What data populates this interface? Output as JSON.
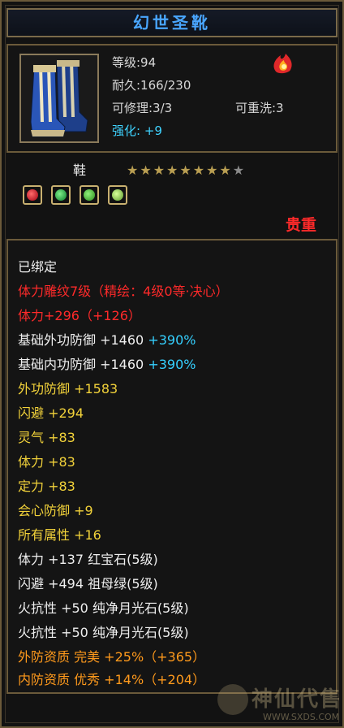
{
  "title": "幻世圣靴",
  "item": {
    "level": "等级:94",
    "durability": "耐久:166/230",
    "repair": "可修理:3/3",
    "rewash": "可重洗:3",
    "enhance": "强化: +9",
    "icon": "boots-icon",
    "type_icon": "flame-icon"
  },
  "slot": {
    "label": "鞋",
    "stars_total": 9,
    "stars_filled": 8,
    "gems": [
      "ruby-gem-icon",
      "emerald-gem-icon",
      "emerald-gem-icon",
      "moonstone-gem-icon"
    ]
  },
  "rarity": "贵重",
  "attributes": [
    {
      "text": "已绑定",
      "color": "white"
    },
    {
      "text": "体力雕纹7级（精绘：4级0等·决心）",
      "color": "red"
    },
    {
      "text": "体力+296（+126）",
      "color": "red"
    },
    {
      "text": "基础外功防御 +1460",
      "extra": "+390%",
      "color": "white"
    },
    {
      "text": "基础内功防御 +1460",
      "extra": "+390%",
      "color": "white"
    },
    {
      "text": "外功防御 +1583",
      "color": "yellow"
    },
    {
      "text": "闪避 +294",
      "color": "yellow"
    },
    {
      "text": "灵气 +83",
      "color": "yellow"
    },
    {
      "text": "体力 +83",
      "color": "yellow"
    },
    {
      "text": "定力 +83",
      "color": "yellow"
    },
    {
      "text": "会心防御 +9",
      "color": "yellow"
    },
    {
      "text": "所有属性 +16",
      "color": "yellow"
    },
    {
      "text": "体力 +137 红宝石(5级)",
      "color": "white"
    },
    {
      "text": "闪避 +494 祖母绿(5级)",
      "color": "white"
    },
    {
      "text": "火抗性 +50 纯净月光石(5级)",
      "color": "white"
    },
    {
      "text": "火抗性 +50 纯净月光石(5级)",
      "color": "white"
    },
    {
      "text": "外防资质  完美 +25%（+365）",
      "color": "orange"
    },
    {
      "text": "内防资质  优秀 +14%（+204）",
      "color": "orange"
    }
  ],
  "watermark": {
    "text": "神仙代售",
    "url": "WWW.SXDS.COM"
  },
  "colors": {
    "title": "#49a6ff",
    "red": "#ff2a2a",
    "yellow": "#f2d23a",
    "orange": "#ff9a1c",
    "cyan": "#35d0ff",
    "star": "#b99e52"
  }
}
